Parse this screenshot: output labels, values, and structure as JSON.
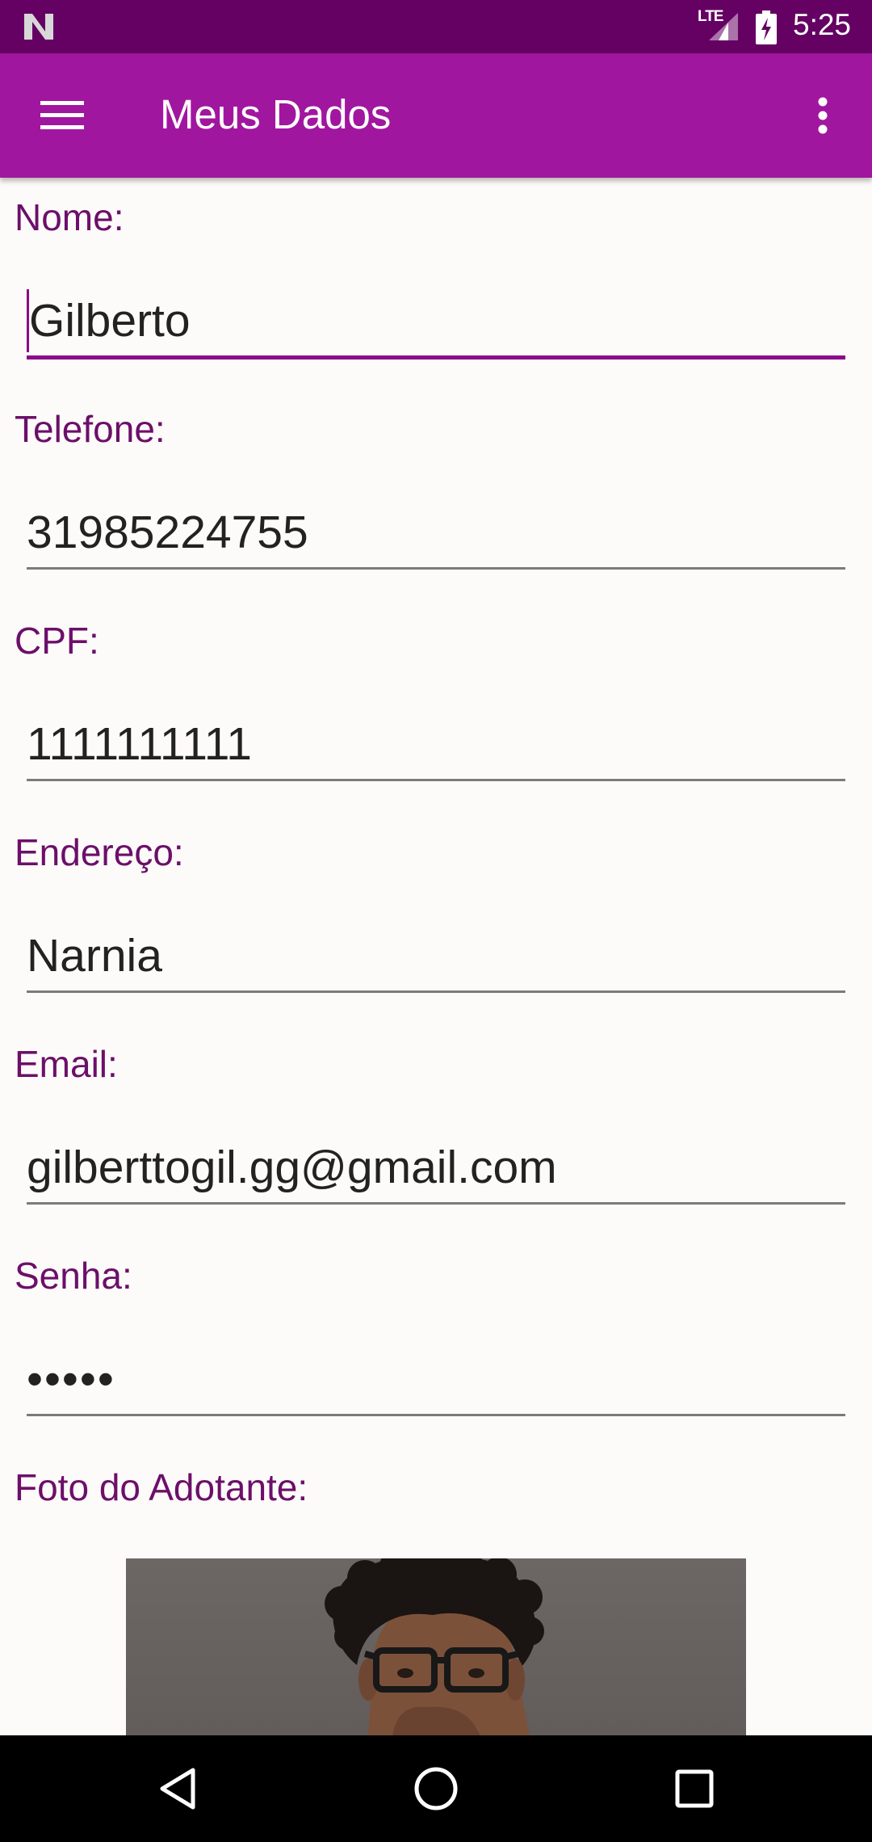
{
  "status_bar": {
    "network": "LTE",
    "time": "5:25",
    "icons": [
      "notification-n-icon",
      "signal-icon",
      "battery-charging-icon"
    ],
    "background": "#650163"
  },
  "app_bar": {
    "title": "Meus Dados",
    "background": "#a1169f",
    "icons": [
      "menu-icon",
      "more-vert-icon"
    ]
  },
  "form": {
    "fields": [
      {
        "label": "Nome:",
        "value": "Gilberto"
      },
      {
        "label": "Telefone:",
        "value": "31985224755"
      },
      {
        "label": "CPF:",
        "value": "1111111111"
      },
      {
        "label": "Endereço:",
        "value": "Narnia"
      },
      {
        "label": "Email:",
        "value": "gilberttogil.gg@gmail.com"
      },
      {
        "label": "Senha:",
        "value": "•••••"
      }
    ],
    "photo_label": "Foto do Adotante:",
    "label_color": "#6c0f6a",
    "accent_color": "#8a0e88"
  },
  "nav_bar": {
    "icons": [
      "back-icon",
      "home-icon",
      "recents-icon"
    ]
  }
}
